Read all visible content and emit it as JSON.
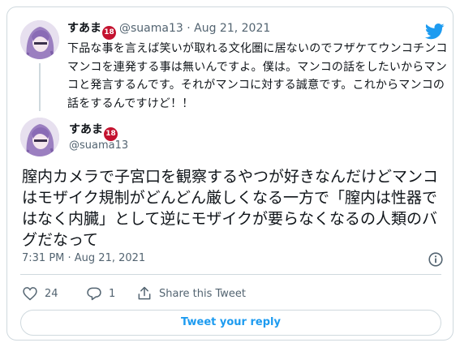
{
  "parent_tweet": {
    "display_name": "すあま",
    "badge": "18",
    "handle": "@suama13",
    "separator": "·",
    "date": "Aug 21, 2021",
    "text": "下品な事を言えば笑いが取れる文化圏に居ないのでフザケてウンコチンコマンコを連発する事は無いんですよ。僕は。マンコの話をしたいからマンコと発言するんです。それがマンコに対する誠意です。これからマンコの話をするんですけど！！"
  },
  "main_tweet": {
    "display_name": "すあま",
    "badge": "18",
    "handle": "@suama13",
    "text": "膣内カメラで子宮口を観察するやつが好きなんだけどマンコはモザイク規制がどんどん厳しくなる一方で「膣内は性器ではなく内臓」として逆にモザイクが要らなくなるの人類のバグだなって",
    "timestamp": "7:31 PM · Aug 21, 2021"
  },
  "actions": {
    "like_count": "24",
    "reply_count": "1",
    "share_label": "Share this Tweet"
  },
  "reply_button_label": "Tweet your reply",
  "icons": {
    "brand": "twitter-bird-icon",
    "like": "heart-icon",
    "reply": "reply-bubble-icon",
    "share": "share-icon",
    "info": "info-icon"
  },
  "colors": {
    "accent": "#1d9bf0",
    "text": "#0f1419",
    "muted": "#536471",
    "border": "#cfd9de",
    "badge": "#c4122f"
  }
}
